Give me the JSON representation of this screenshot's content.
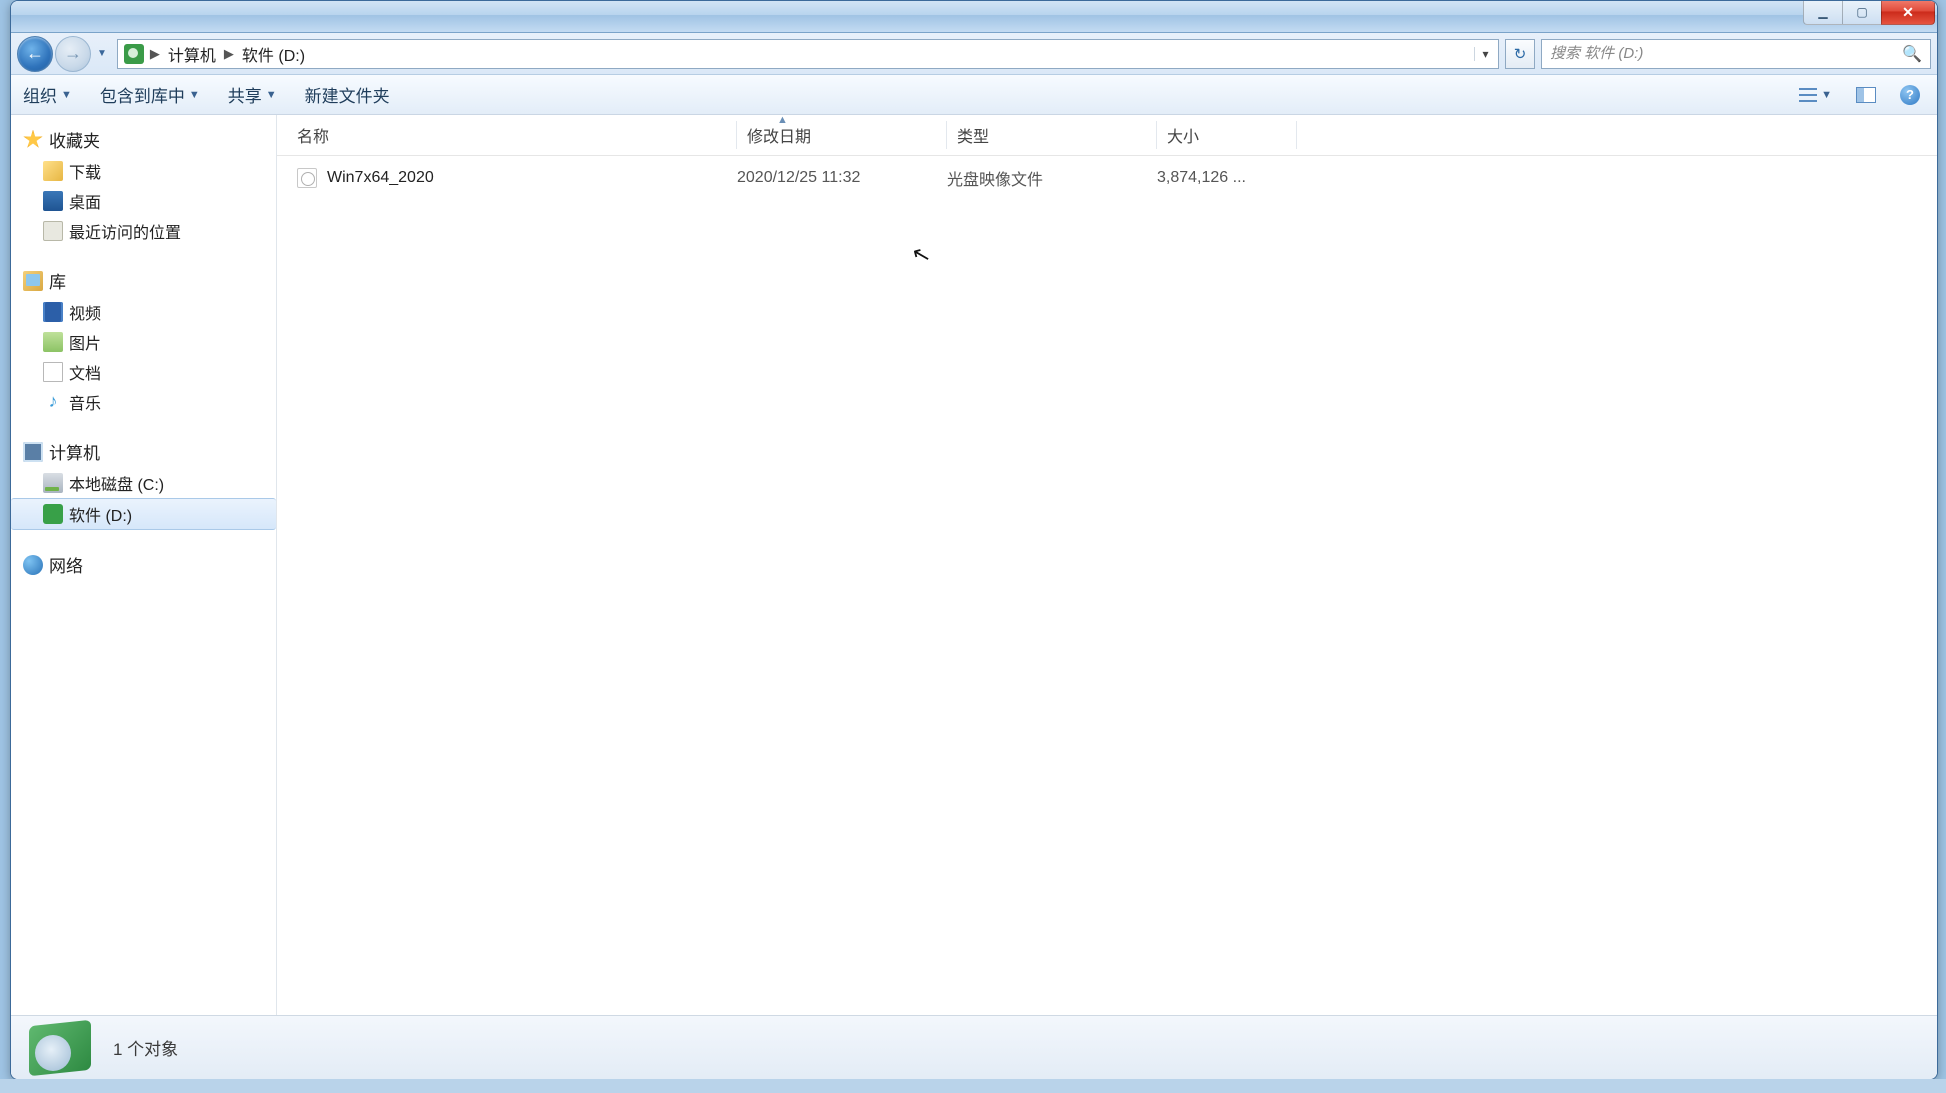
{
  "breadcrumb": {
    "l1": "计算机",
    "l2": "软件 (D:)"
  },
  "search": {
    "placeholder": "搜索 软件 (D:)"
  },
  "toolbar": {
    "organize": "组织",
    "include": "包含到库中",
    "share": "共享",
    "newfolder": "新建文件夹"
  },
  "columns": {
    "name": "名称",
    "date": "修改日期",
    "type": "类型",
    "size": "大小"
  },
  "sidebar": {
    "favorites": "收藏夹",
    "downloads": "下载",
    "desktop": "桌面",
    "recent": "最近访问的位置",
    "libraries": "库",
    "videos": "视频",
    "pictures": "图片",
    "documents": "文档",
    "music": "音乐",
    "computer": "计算机",
    "disk_c": "本地磁盘 (C:)",
    "disk_d": "软件 (D:)",
    "network": "网络"
  },
  "files": [
    {
      "name": "Win7x64_2020",
      "date": "2020/12/25 11:32",
      "type": "光盘映像文件",
      "size": "3,874,126 ..."
    }
  ],
  "status": {
    "text": "1 个对象"
  }
}
